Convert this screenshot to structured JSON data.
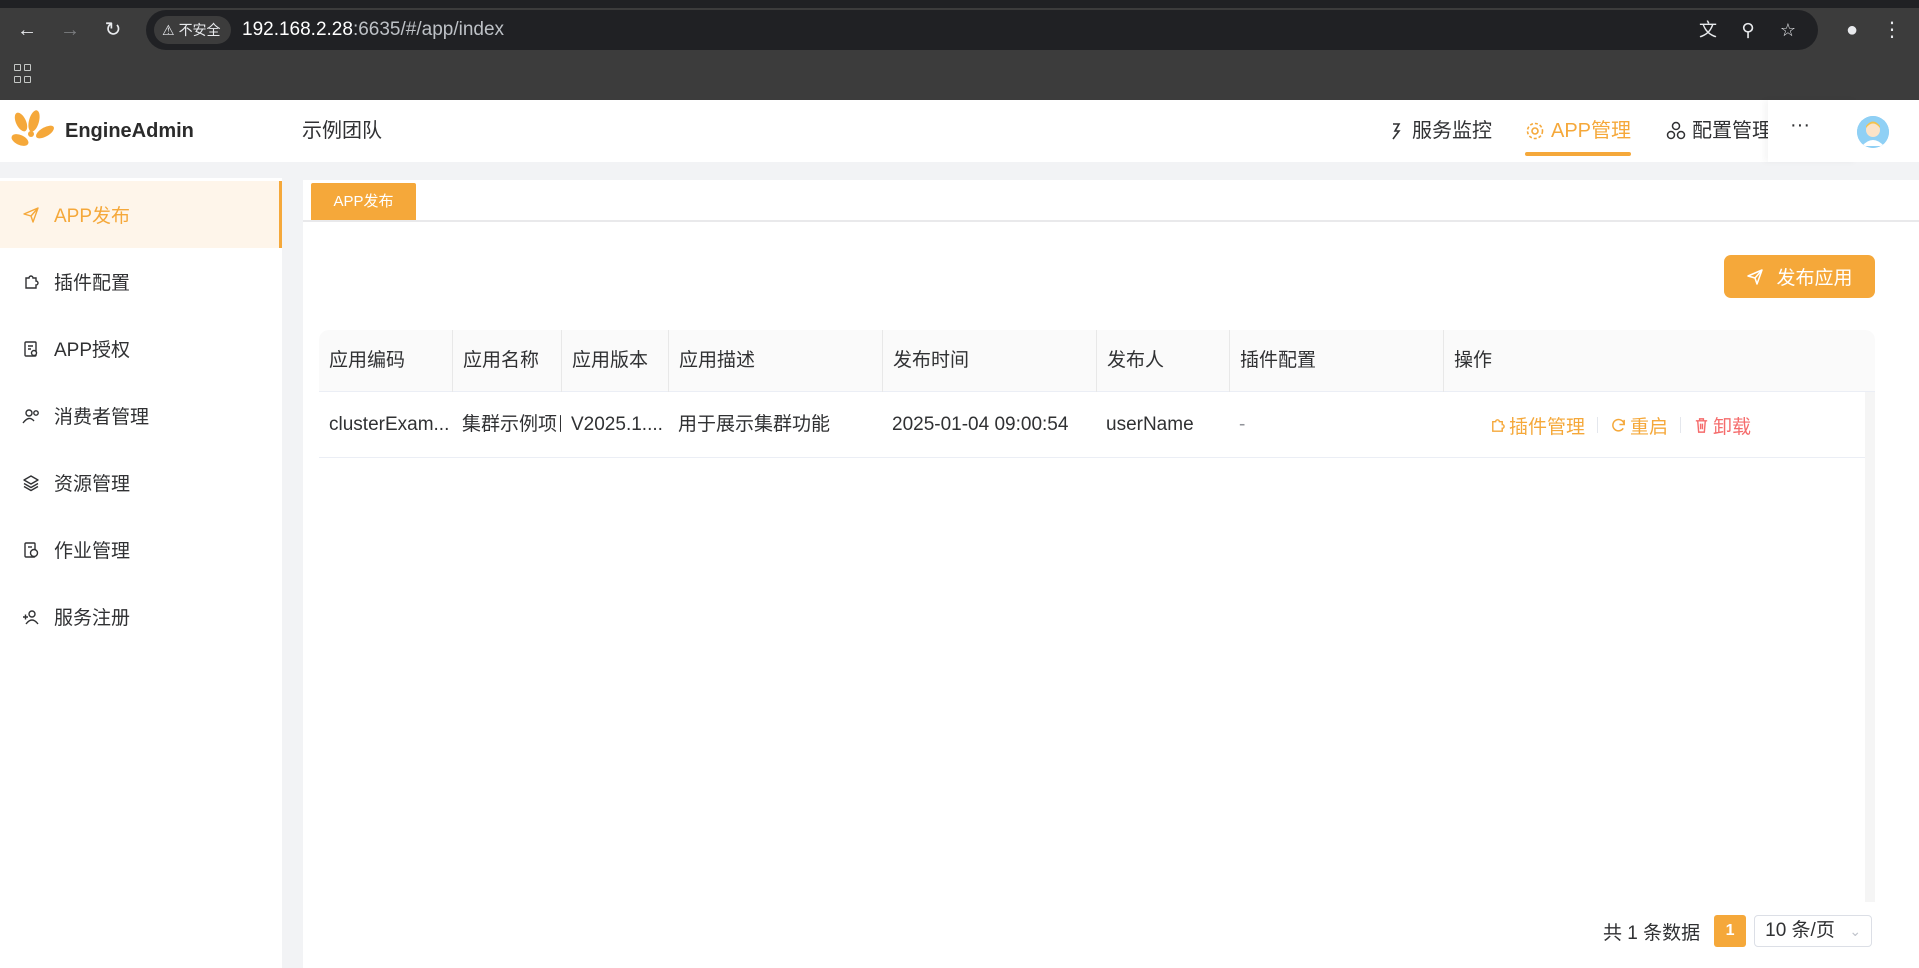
{
  "browser": {
    "insecure_label": "不安全",
    "url_host": "192.168.2.28",
    "url_rest": ":6635/#/app/index"
  },
  "header": {
    "brand": "EngineAdmin",
    "team": "示例团队",
    "nav": [
      {
        "label": "服务监控",
        "icon": "monitor-icon"
      },
      {
        "label": "APP管理",
        "icon": "gear-icon"
      },
      {
        "label": "配置管理",
        "icon": "cluster-icon"
      }
    ],
    "more": "···"
  },
  "sidebar": {
    "items": [
      {
        "label": "APP发布",
        "icon": "send-icon"
      },
      {
        "label": "插件配置",
        "icon": "puzzle-icon"
      },
      {
        "label": "APP授权",
        "icon": "license-icon"
      },
      {
        "label": "消费者管理",
        "icon": "user-gear-icon"
      },
      {
        "label": "资源管理",
        "icon": "layers-icon"
      },
      {
        "label": "作业管理",
        "icon": "job-icon"
      },
      {
        "label": "服务注册",
        "icon": "user-add-icon"
      }
    ]
  },
  "main": {
    "tab": "APP发布",
    "publish_button": "发布应用",
    "table": {
      "columns": [
        "应用编码",
        "应用名称",
        "应用版本",
        "应用描述",
        "发布时间",
        "发布人",
        "插件配置",
        "操作"
      ],
      "rows": [
        {
          "code": "clusterExam...",
          "name": "集群示例项目",
          "version": "V2025.1....",
          "description": "用于展示集群功能",
          "time": "2025-01-04 09:00:54",
          "publisher": "userName",
          "plugin": "-",
          "actions": [
            "插件管理",
            "重启",
            "卸载"
          ]
        }
      ]
    },
    "pagination": {
      "total": "共 1 条数据",
      "current_page": "1",
      "page_size": "10 条/页"
    }
  },
  "colors": {
    "accent": "#f5a83a",
    "danger": "#f56c6c"
  }
}
